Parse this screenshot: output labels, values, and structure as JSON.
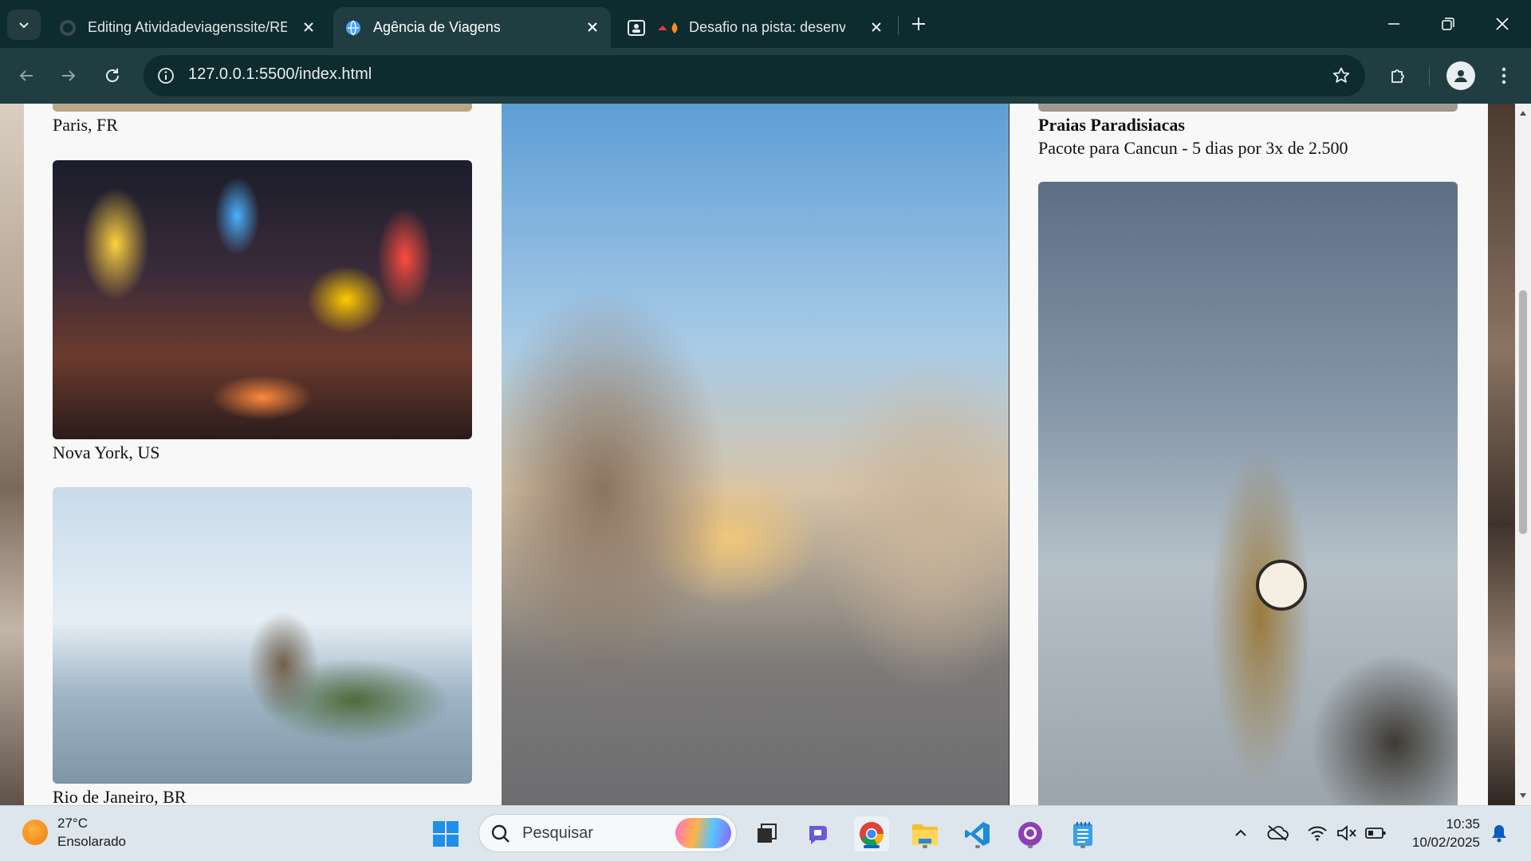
{
  "browser": {
    "tabs": [
      {
        "title": "Editing Atividadeviagenssite/RE",
        "icon": "github-icon"
      },
      {
        "title": "Agência de Viagens",
        "icon": "globe-icon"
      },
      {
        "title": "Desafio na pista: desenv",
        "icon": "game-icon"
      }
    ],
    "address": "127.0.0.1:5500/index.html"
  },
  "page": {
    "left_column": [
      {
        "caption": "Paris, FR"
      },
      {
        "caption": "Nova York, US"
      },
      {
        "caption": "Rio de Janeiro, BR"
      }
    ],
    "right_column": {
      "promo_title": "Praias Paradisiacas",
      "promo_text": "Pacote para Cancun - 5 dias por 3x de 2.500"
    }
  },
  "taskbar": {
    "weather_temp": "27°C",
    "weather_desc": "Ensolarado",
    "search_placeholder": "Pesquisar",
    "time": "10:35",
    "date": "10/02/2025"
  }
}
